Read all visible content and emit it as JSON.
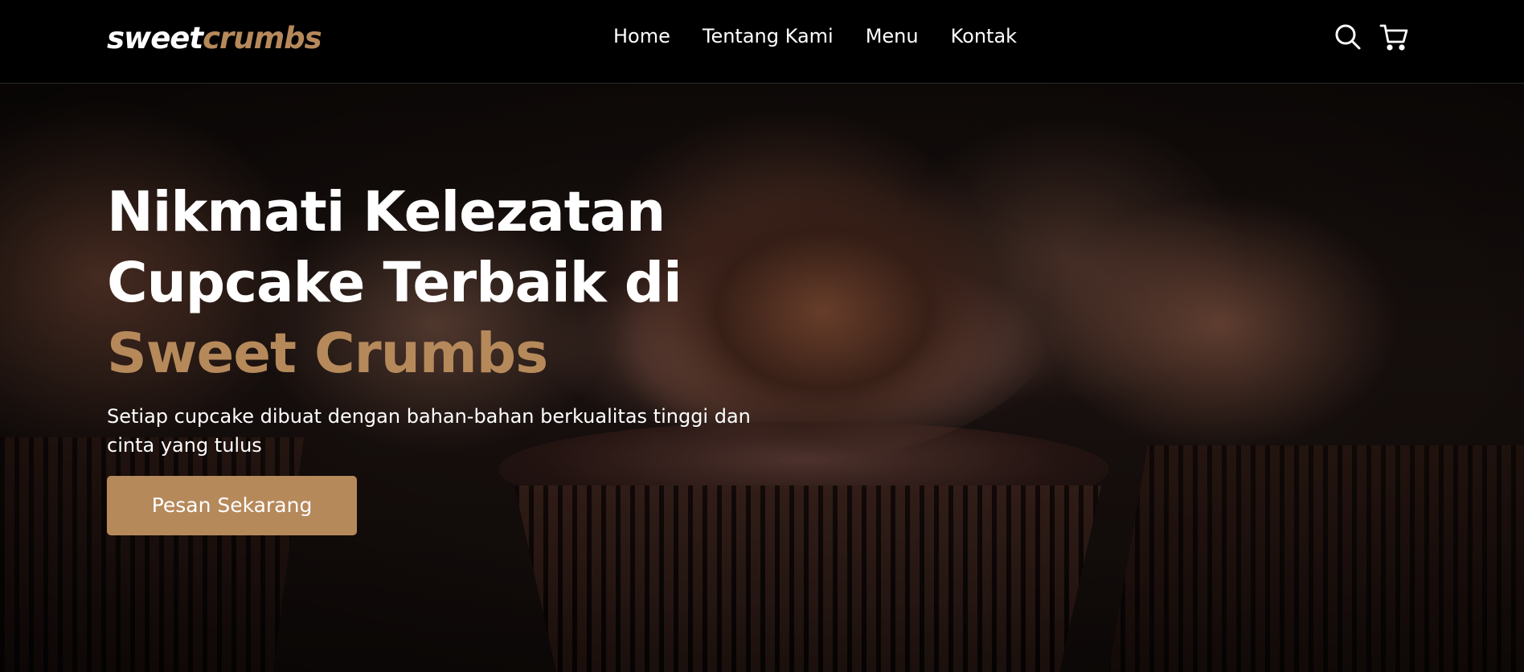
{
  "brand": {
    "logo_part1": "sweet",
    "logo_part2": "crumbs",
    "accent_color": "#b6895b"
  },
  "nav": {
    "links": [
      {
        "label": "Home"
      },
      {
        "label": "Tentang Kami"
      },
      {
        "label": "Menu"
      },
      {
        "label": "Kontak"
      }
    ],
    "search_icon": "search-icon",
    "cart_icon": "cart-icon"
  },
  "hero": {
    "title_line1": "Nikmati Kelezatan",
    "title_line2": "Cupcake Terbaik di",
    "title_accent": "Sweet Crumbs",
    "description": "Setiap cupcake dibuat dengan bahan-bahan berkualitas tinggi dan cinta yang tulus",
    "cta_label": "Pesan Sekarang"
  }
}
